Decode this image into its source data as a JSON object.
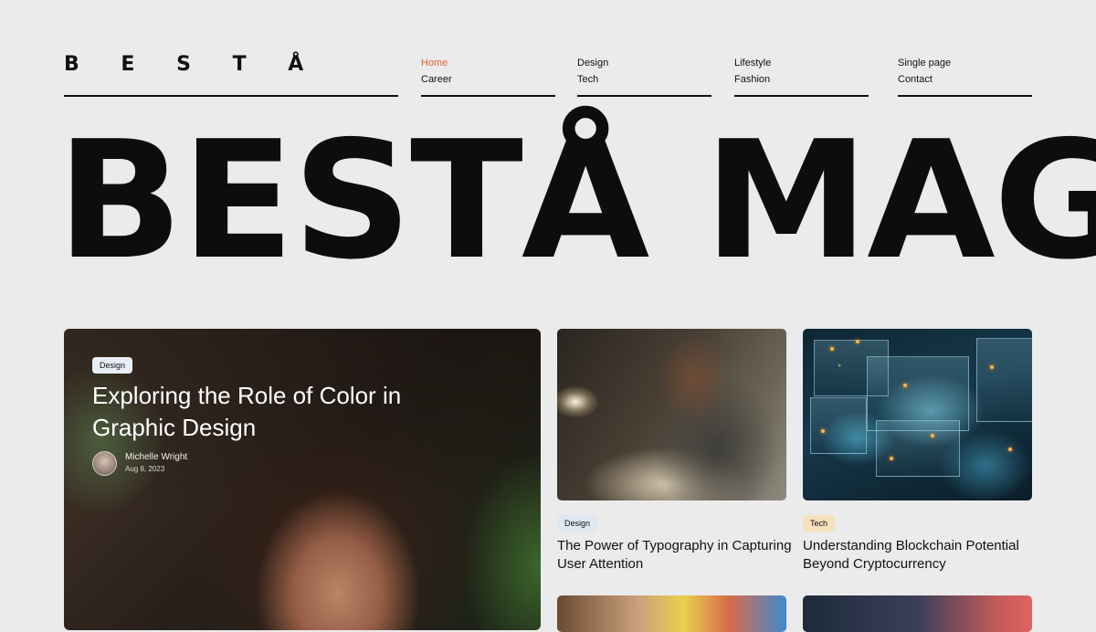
{
  "brand": {
    "logo": "B E S T Å",
    "hero_title": "BESTÅ MAG"
  },
  "nav": {
    "columns": [
      {
        "items": [
          {
            "label": "Home",
            "active": true
          },
          {
            "label": "Career",
            "active": false
          }
        ]
      },
      {
        "items": [
          {
            "label": "Design",
            "active": false
          },
          {
            "label": "Tech",
            "active": false
          }
        ]
      },
      {
        "items": [
          {
            "label": "Lifestyle",
            "active": false
          },
          {
            "label": "Fashion",
            "active": false
          }
        ]
      },
      {
        "items": [
          {
            "label": "Single page",
            "active": false
          },
          {
            "label": "Contact",
            "active": false
          }
        ]
      }
    ]
  },
  "featured": {
    "tag": "Design",
    "title": "Exploring the Role of Color in Graphic Design",
    "author": "Michelle Wright",
    "date": "Aug 8, 2023"
  },
  "cards": [
    {
      "tag": "Design",
      "title": "The Power of Typography in Capturing User Attention"
    },
    {
      "tag": "Tech",
      "title": "Understanding Blockchain Potential Beyond Cryptocurrency"
    }
  ],
  "colors": {
    "accent": "#e0603a",
    "background": "#ebebeb",
    "tag_design": "#dde8f3",
    "tag_tech": "#f6e1bd"
  }
}
